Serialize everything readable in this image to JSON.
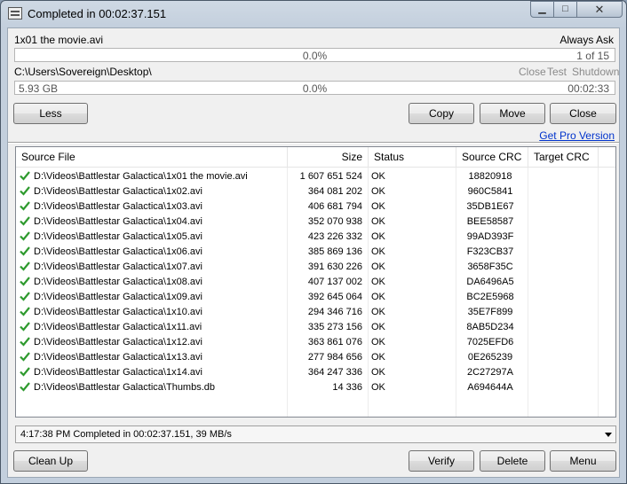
{
  "window": {
    "title": "Completed in 00:02:37.151",
    "controls": {
      "minimize": "▁",
      "maximize": "□",
      "close": "✕"
    }
  },
  "file_progress": {
    "filename": "1x01 the movie.avi",
    "mode": "Always Ask",
    "percent": "0.0%",
    "count": "1 of 15",
    "progress_fraction": 0.0
  },
  "total_progress": {
    "path": "C:\\Users\\Sovereign\\Desktop\\",
    "after_options": [
      "Close",
      "Test",
      "Shutdown"
    ],
    "size": "5.93 GB",
    "percent": "0.0%",
    "time": "00:02:33",
    "progress_fraction": 0.0
  },
  "buttons_top": {
    "less": "Less",
    "copy": "Copy",
    "move": "Move",
    "close": "Close"
  },
  "pro_link": "Get Pro Version",
  "table": {
    "headers": [
      "Source File",
      "Size",
      "Status",
      "Source CRC",
      "Target CRC"
    ],
    "rows": [
      {
        "file": "D:\\Videos\\Battlestar Galactica\\1x01 the movie.avi",
        "size": "1 607 651 524",
        "status": "OK",
        "crc": "18820918"
      },
      {
        "file": "D:\\Videos\\Battlestar Galactica\\1x02.avi",
        "size": "364 081 202",
        "status": "OK",
        "crc": "960C5841"
      },
      {
        "file": "D:\\Videos\\Battlestar Galactica\\1x03.avi",
        "size": "406 681 794",
        "status": "OK",
        "crc": "35DB1E67"
      },
      {
        "file": "D:\\Videos\\Battlestar Galactica\\1x04.avi",
        "size": "352 070 938",
        "status": "OK",
        "crc": "BEE58587"
      },
      {
        "file": "D:\\Videos\\Battlestar Galactica\\1x05.avi",
        "size": "423 226 332",
        "status": "OK",
        "crc": "99AD393F"
      },
      {
        "file": "D:\\Videos\\Battlestar Galactica\\1x06.avi",
        "size": "385 869 136",
        "status": "OK",
        "crc": "F323CB37"
      },
      {
        "file": "D:\\Videos\\Battlestar Galactica\\1x07.avi",
        "size": "391 630 226",
        "status": "OK",
        "crc": "3658F35C"
      },
      {
        "file": "D:\\Videos\\Battlestar Galactica\\1x08.avi",
        "size": "407 137 002",
        "status": "OK",
        "crc": "DA6496A5"
      },
      {
        "file": "D:\\Videos\\Battlestar Galactica\\1x09.avi",
        "size": "392 645 064",
        "status": "OK",
        "crc": "BC2E5968"
      },
      {
        "file": "D:\\Videos\\Battlestar Galactica\\1x10.avi",
        "size": "294 346 716",
        "status": "OK",
        "crc": "35E7F899"
      },
      {
        "file": "D:\\Videos\\Battlestar Galactica\\1x11.avi",
        "size": "335 273 156",
        "status": "OK",
        "crc": "8AB5D234"
      },
      {
        "file": "D:\\Videos\\Battlestar Galactica\\1x12.avi",
        "size": "363 861 076",
        "status": "OK",
        "crc": "7025EFD6"
      },
      {
        "file": "D:\\Videos\\Battlestar Galactica\\1x13.avi",
        "size": "277 984 656",
        "status": "OK",
        "crc": "0E265239"
      },
      {
        "file": "D:\\Videos\\Battlestar Galactica\\1x14.avi",
        "size": "364 247 336",
        "status": "OK",
        "crc": "2C27297A"
      },
      {
        "file": "D:\\Videos\\Battlestar Galactica\\Thumbs.db",
        "size": "14 336",
        "status": "OK",
        "crc": "A694644A"
      }
    ]
  },
  "status_line": "4:17:38 PM Completed in 00:02:37.151, 39 MB/s",
  "buttons_bottom": {
    "cleanup": "Clean Up",
    "verify": "Verify",
    "delete": "Delete",
    "menu": "Menu"
  },
  "colors": {
    "check": "#2e9a2e",
    "link": "#0033cc"
  }
}
